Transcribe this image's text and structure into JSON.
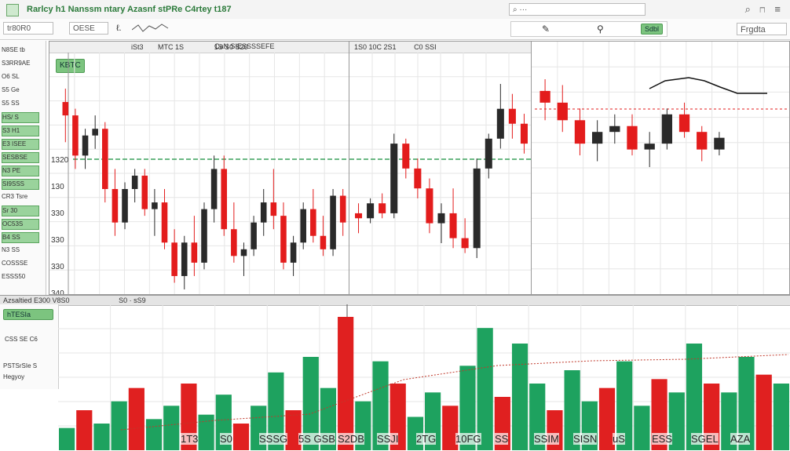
{
  "window": {
    "title": "Rarlcy h1 Nanssm ntary Azasnf stPRe C4rtey t187",
    "controls": "⌕ ⊓ ≡"
  },
  "toolbar": {
    "ticker_field": "tr80R0",
    "price_field": "OESE",
    "small_label": "ℓ.",
    "search_placeholder": "⌕ ···",
    "right_button": "Frgdta",
    "action_button": "Sdbl",
    "icons": [
      "search-icon",
      "draw-icon",
      "indicator-icon"
    ]
  },
  "sidebar": {
    "items": [
      {
        "label": "N8SE tb",
        "highlight": false
      },
      {
        "label": "S3RR9AE",
        "highlight": false
      },
      {
        "label": "O6 SL",
        "highlight": false
      },
      {
        "label": "S5 Ge",
        "highlight": false
      },
      {
        "label": "S5 SS",
        "highlight": false
      },
      {
        "label": "HS/ S",
        "highlight": true
      },
      {
        "label": "S3 H1",
        "highlight": true
      },
      {
        "label": "E3 ISEE",
        "highlight": true
      },
      {
        "label": "SESBSE",
        "highlight": true
      },
      {
        "label": "N3 PE",
        "highlight": true
      },
      {
        "label": "SI9SSS",
        "highlight": true
      },
      {
        "label": "CR3 Tsre",
        "highlight": false
      },
      {
        "label": "Sr 30",
        "highlight": true
      },
      {
        "label": "OC53S",
        "highlight": true
      },
      {
        "label": "B4 SS",
        "highlight": true
      },
      {
        "label": "N3 SS",
        "highlight": false
      },
      {
        "label": "COSSSE",
        "highlight": false
      },
      {
        "label": "ESSS50",
        "highlight": false
      }
    ]
  },
  "panes": {
    "left": {
      "header_items": [
        "iSt3",
        "MTC 1S",
        "1S S0 S20"
      ],
      "header_title": "CaN SIESSSSEFE",
      "tag": "KBTC",
      "yticks": [
        "1320",
        "130",
        "330",
        "330",
        "330",
        "340"
      ]
    },
    "middle": {
      "header_items": [
        "1S0 10C 2S1",
        "C0 SSI"
      ]
    }
  },
  "midbar": {
    "text": "Azsaltied E300 V8S0",
    "extra": "S0 · sS9"
  },
  "bottom_panel": {
    "items": [
      "hTESIa",
      "CSS SE C6",
      "PSTSrSIe S",
      "Hegyoy"
    ],
    "tag": "hTESIa"
  },
  "bottom_labels": [
    "1T3",
    "S0",
    "SSSG",
    "5S GSB",
    "S2DB",
    "SSJI",
    "2TG",
    "10FG",
    "SS",
    "SSIM",
    "SISN",
    "uS",
    "ESS",
    "SGEL",
    "AZA"
  ],
  "chart_data": [
    {
      "type": "candlestick",
      "title": "",
      "series": [
        {
          "name": "",
          "ohlc": [
            [
              60,
              64,
              48,
              56
            ],
            [
              56,
              58,
              40,
              44
            ],
            [
              44,
              52,
              40,
              50
            ],
            [
              50,
              56,
              46,
              52
            ],
            [
              52,
              54,
              30,
              34
            ],
            [
              34,
              40,
              20,
              24
            ],
            [
              24,
              36,
              22,
              34
            ],
            [
              34,
              40,
              30,
              38
            ],
            [
              38,
              40,
              26,
              28
            ],
            [
              28,
              34,
              20,
              30
            ],
            [
              30,
              34,
              16,
              18
            ],
            [
              18,
              22,
              6,
              8
            ],
            [
              8,
              20,
              4,
              18
            ],
            [
              18,
              26,
              8,
              12
            ],
            [
              12,
              30,
              10,
              28
            ],
            [
              28,
              44,
              24,
              40
            ],
            [
              40,
              44,
              20,
              22
            ],
            [
              22,
              30,
              12,
              14
            ],
            [
              14,
              18,
              8,
              16
            ],
            [
              16,
              26,
              14,
              24
            ],
            [
              24,
              34,
              20,
              30
            ],
            [
              30,
              40,
              22,
              26
            ],
            [
              26,
              30,
              10,
              12
            ],
            [
              12,
              20,
              8,
              18
            ],
            [
              18,
              30,
              16,
              28
            ],
            [
              28,
              34,
              18,
              20
            ],
            [
              20,
              26,
              14,
              16
            ],
            [
              16,
              34,
              14,
              32
            ],
            [
              32,
              34,
              20,
              24
            ]
          ]
        }
      ]
    },
    {
      "type": "candlestick",
      "title": "",
      "series": [
        {
          "name": "",
          "ohlc": [
            [
              30,
              34,
              22,
              28
            ],
            [
              28,
              36,
              26,
              34
            ],
            [
              34,
              38,
              28,
              30
            ],
            [
              30,
              62,
              28,
              58
            ],
            [
              58,
              60,
              44,
              48
            ],
            [
              48,
              52,
              36,
              40
            ],
            [
              40,
              44,
              22,
              26
            ],
            [
              26,
              34,
              18,
              30
            ],
            [
              30,
              40,
              16,
              20
            ],
            [
              20,
              28,
              14,
              16
            ],
            [
              16,
              52,
              12,
              48
            ],
            [
              48,
              62,
              44,
              60
            ],
            [
              60,
              82,
              56,
              72
            ],
            [
              72,
              78,
              60,
              66
            ],
            [
              66,
              70,
              54,
              58
            ]
          ]
        }
      ]
    },
    {
      "type": "candlestick",
      "title": "",
      "series": [
        {
          "name": "",
          "ohlc": [
            [
              70,
              74,
              60,
              66
            ],
            [
              66,
              72,
              56,
              60
            ],
            [
              60,
              64,
              48,
              52
            ],
            [
              52,
              60,
              46,
              56
            ],
            [
              56,
              62,
              52,
              58
            ],
            [
              58,
              62,
              48,
              50
            ],
            [
              50,
              56,
              44,
              52
            ],
            [
              52,
              64,
              50,
              62
            ],
            [
              62,
              66,
              54,
              56
            ],
            [
              56,
              58,
              46,
              50
            ],
            [
              50,
              56,
              48,
              54
            ]
          ]
        }
      ]
    },
    {
      "type": "bar",
      "title": "",
      "series": [
        {
          "name": "",
          "values": [
            10,
            18,
            12,
            22,
            28,
            14,
            20,
            30,
            16,
            25,
            12,
            20,
            35,
            18,
            42,
            28,
            60,
            22,
            40,
            30,
            15,
            26,
            20,
            38,
            55,
            24,
            48,
            30,
            18,
            36,
            22,
            28,
            40,
            20,
            32,
            26,
            48,
            30,
            26,
            42,
            34,
            30
          ]
        }
      ]
    }
  ],
  "colors": {
    "up": "#2a2a2a",
    "down": "#e31c1c",
    "volume_green": "#1ea25f",
    "volume_red": "#e02020",
    "accent": "#5fae5f"
  }
}
